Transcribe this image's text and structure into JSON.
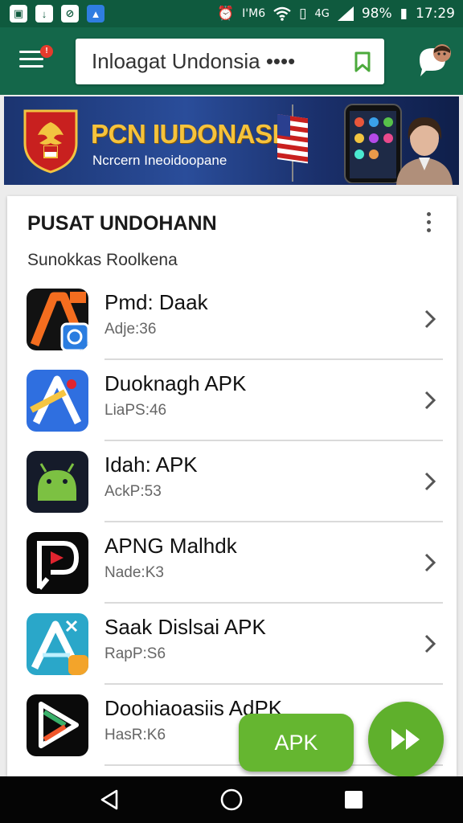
{
  "status_bar": {
    "carrier_text": "I'M6",
    "network": "4G",
    "battery": "98%",
    "time": "17:29"
  },
  "header": {
    "search_query": "Inloagat Undonsia ••••",
    "notification_badge": "!"
  },
  "banner": {
    "title": "PCN IUDONASIA",
    "subtitle": "Ncrcern Ineoidoopane"
  },
  "section": {
    "title": "PUSAT UNDOHANN",
    "subtitle": "Sunokkas  Roolkena"
  },
  "apps": [
    {
      "name": "Pmd: Daak",
      "meta": "Adje:36",
      "icon": "orange-a-icon",
      "colors": [
        "#121212",
        "#f46d1f",
        "#2b7de0"
      ]
    },
    {
      "name": "Duoknagh APK",
      "meta": "LiaPS:46",
      "icon": "blue-a-icon",
      "colors": [
        "#2f6fe0",
        "#ffffff",
        "#f5c542"
      ]
    },
    {
      "name": "Idah: APK",
      "meta": "AckP:53",
      "icon": "android-icon",
      "colors": [
        "#151b2a",
        "#7cc142"
      ]
    },
    {
      "name": "APNG Malhdk",
      "meta": "Nade:K3",
      "icon": "play-p-icon",
      "colors": [
        "#0a0a0a",
        "#ffffff",
        "#e0242f"
      ]
    },
    {
      "name": "Saak Dislsai APK",
      "meta": "RapP:S6",
      "icon": "teal-a-icon",
      "colors": [
        "#2aa7c9",
        "#ffffff",
        "#f3a42a"
      ]
    },
    {
      "name": "Doohiaoasiis AdPK",
      "meta": "HasR:K6",
      "icon": "play-store-icon",
      "colors": [
        "#0a0a0a",
        "#ffffff",
        "#3ab06a",
        "#f0562a"
      ]
    }
  ],
  "buttons": {
    "apk_label": "APK"
  },
  "colors": {
    "appbar": "#14674a",
    "statusbar": "#0f5a3e",
    "accent_green": "#65b630",
    "banner_title": "#f6c33c"
  }
}
